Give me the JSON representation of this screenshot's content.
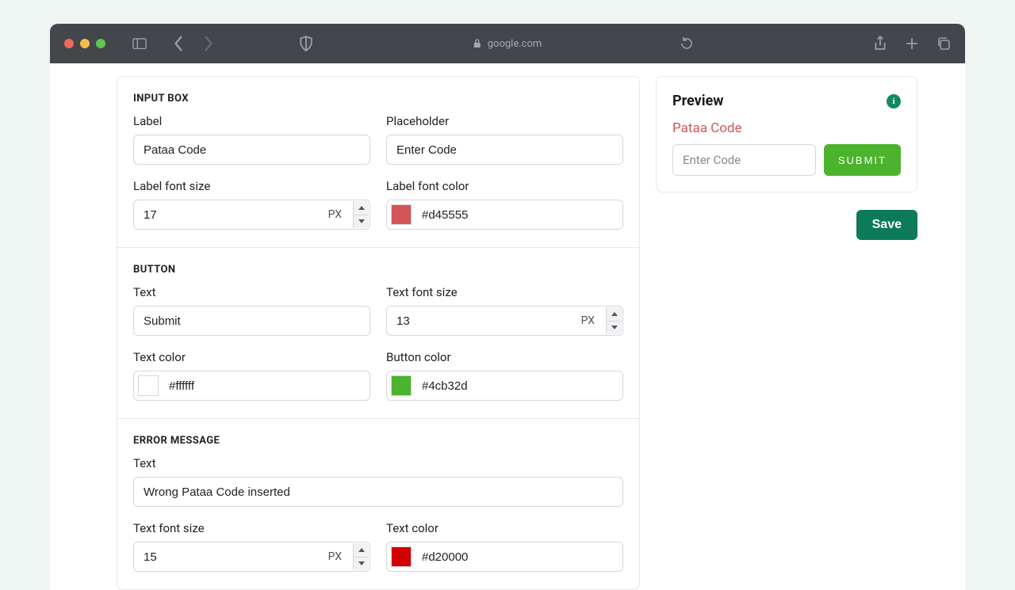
{
  "browser": {
    "url": "google.com"
  },
  "inputBox": {
    "title": "INPUT BOX",
    "labelLabel": "Label",
    "labelValue": "Pataa Code",
    "placeholderLabel": "Placeholder",
    "placeholderValue": "Enter Code",
    "fontSizeLabel": "Label font size",
    "fontSizeValue": "17",
    "fontSizeUnit": "PX",
    "fontColorLabel": "Label font color",
    "fontColorValue": "#d45555"
  },
  "button": {
    "title": "BUTTON",
    "textLabel": "Text",
    "textValue": "Submit",
    "fontSizeLabel": "Text font size",
    "fontSizeValue": "13",
    "fontSizeUnit": "PX",
    "textColorLabel": "Text color",
    "textColorValue": "#ffffff",
    "bgColorLabel": "Button color",
    "bgColorValue": "#4cb32d"
  },
  "error": {
    "title": "ERROR MESSAGE",
    "textLabel": "Text",
    "textValue": "Wrong Pataa Code inserted",
    "fontSizeLabel": "Text font size",
    "fontSizeValue": "15",
    "fontSizeUnit": "PX",
    "colorLabel": "Text color",
    "colorValue": "#d20000"
  },
  "preview": {
    "title": "Preview",
    "label": "Pataa Code",
    "placeholder": "Enter Code",
    "button": "SUBMIT"
  },
  "save": "Save"
}
